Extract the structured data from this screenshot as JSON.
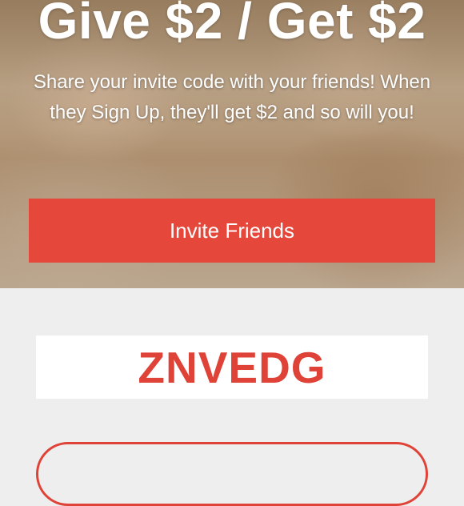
{
  "hero": {
    "title": "Give $2 / Get $2",
    "description": "Share your invite code with your friends! When they Sign Up, they'll get $2 and so will you!",
    "invite_button_label": "Invite Friends"
  },
  "invite_code": {
    "code": "ZNVEDG"
  },
  "colors": {
    "accent": "#e5473b",
    "code_text": "#df4237",
    "background": "#eeeeee"
  }
}
